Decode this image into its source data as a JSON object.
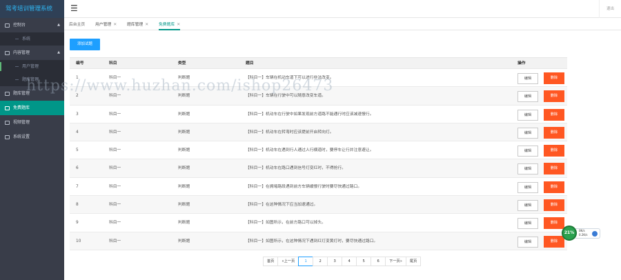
{
  "app": {
    "title": "驾考培训管理系统",
    "logout_label": "退出"
  },
  "sidebar": {
    "items": [
      {
        "label": "控制台",
        "icon": "dashboard-icon",
        "expanded": true,
        "children": [
          {
            "label": "系统"
          }
        ]
      },
      {
        "label": "内容管理",
        "icon": "content-icon",
        "expanded": true,
        "children": [
          {
            "label": "用户管理"
          },
          {
            "label": "题库管理"
          }
        ]
      },
      {
        "label": "题库管理",
        "icon": "bank-icon"
      },
      {
        "label": "免费题库",
        "icon": "free-icon",
        "active": true
      },
      {
        "label": "视频管理",
        "icon": "video-icon"
      },
      {
        "label": "系统设置",
        "icon": "settings-icon"
      }
    ]
  },
  "tabs": [
    {
      "label": "后台主页",
      "closable": false
    },
    {
      "label": "用户管理",
      "closable": true
    },
    {
      "label": "题库管理",
      "closable": true
    },
    {
      "label": "免费题库",
      "closable": true,
      "active": true
    }
  ],
  "toolbar": {
    "add_label": "添加试题"
  },
  "table": {
    "headers": [
      "编号",
      "科目",
      "类型",
      "题目",
      "操作"
    ],
    "edit_label": "编辑",
    "delete_label": "删除",
    "rows": [
      {
        "id": "1",
        "subject": "科目一",
        "type": "判断题",
        "question": "【科目一】车辆在机动车道下可以进行非法改变。"
      },
      {
        "id": "2",
        "subject": "科目一",
        "type": "判断题",
        "question": "【科目一】车辆在行驶中可以随意改变车道。"
      },
      {
        "id": "3",
        "subject": "科目一",
        "type": "判断题",
        "question": "【科目一】机动车在行驶中如果发现前方道路不能通行时应该减速慢行。"
      },
      {
        "id": "4",
        "subject": "科目一",
        "type": "判断题",
        "question": "【科目一】机动车在转弯时应该提前开启转向灯。"
      },
      {
        "id": "5",
        "subject": "科目一",
        "type": "判断题",
        "question": "【科目一】机动车在遇到行人通过人行横道时，要停车让行并注意避让。"
      },
      {
        "id": "6",
        "subject": "科目一",
        "type": "判断题",
        "question": "【科目一】机动车在路口遇到信号灯变红时，不得抢行。"
      },
      {
        "id": "7",
        "subject": "科目一",
        "type": "判断题",
        "question": "【科目一】在拥堵路段遇到前方车辆缓慢行驶时要尽快通过路口。"
      },
      {
        "id": "8",
        "subject": "科目一",
        "type": "判断题",
        "question": "【科目一】在这种情况下应当加速通过。"
      },
      {
        "id": "9",
        "subject": "科目一",
        "type": "判断题",
        "question": "【科目一】如图所示，在前方路口可以掉头。"
      },
      {
        "id": "10",
        "subject": "科目一",
        "type": "判断题",
        "question": "【科目一】如图所示，在这种情况下遇到红灯变黄灯时，要尽快通过路口。"
      }
    ]
  },
  "pagination": {
    "first": "首页",
    "prev": "«上一页",
    "pages": [
      "1",
      "2",
      "3",
      "4",
      "5",
      "6"
    ],
    "current": "1",
    "next": "下一页»",
    "last": "尾页"
  },
  "widget": {
    "percent": "21%",
    "line1": "0K/s",
    "line2": "0.2K/s"
  },
  "watermark": "https://www.huzhan.com/ishop26473",
  "colors": {
    "sidebar_bg": "#393D49",
    "active_bg": "#009688",
    "primary": "#1E9FFF",
    "danger": "#FF5722",
    "logo_text": "#2fb7f5"
  }
}
